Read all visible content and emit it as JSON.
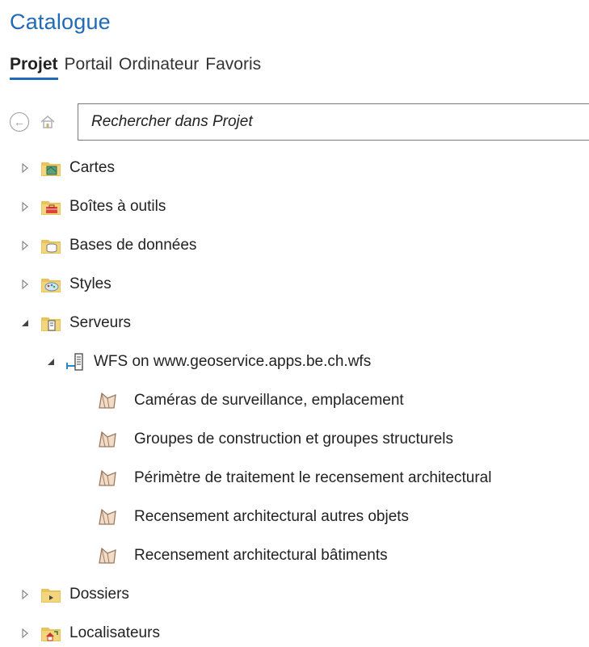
{
  "panel": {
    "title": "Catalogue"
  },
  "tabs": [
    {
      "label": "Projet",
      "active": true
    },
    {
      "label": "Portail",
      "active": false
    },
    {
      "label": "Ordinateur",
      "active": false
    },
    {
      "label": "Favoris",
      "active": false
    }
  ],
  "search": {
    "placeholder": "Rechercher dans Projet",
    "value": ""
  },
  "tree": {
    "items": [
      {
        "label": "Cartes",
        "icon": "maps-folder-icon",
        "expanded": false
      },
      {
        "label": "Boîtes à outils",
        "icon": "toolbox-folder-icon",
        "expanded": false
      },
      {
        "label": "Bases de données",
        "icon": "database-folder-icon",
        "expanded": false
      },
      {
        "label": "Styles",
        "icon": "styles-folder-icon",
        "expanded": false
      },
      {
        "label": "Serveurs",
        "icon": "servers-folder-icon",
        "expanded": true
      },
      {
        "label": "WFS on www.geoservice.apps.be.ch.wfs",
        "icon": "wfs-server-icon",
        "expanded": true
      },
      {
        "label": "Caméras de surveillance, emplacement",
        "icon": "polygon-layer-icon"
      },
      {
        "label": "Groupes de construction et groupes structurels",
        "icon": "polygon-layer-icon"
      },
      {
        "label": "Périmètre de traitement le recensement architectural",
        "icon": "polygon-layer-icon"
      },
      {
        "label": "Recensement architectural autres objets",
        "icon": "polygon-layer-icon"
      },
      {
        "label": "Recensement architectural bâtiments",
        "icon": "polygon-layer-icon"
      },
      {
        "label": "Dossiers",
        "icon": "folders-folder-icon",
        "expanded": false
      },
      {
        "label": "Localisateurs",
        "icon": "locators-folder-icon",
        "expanded": false
      }
    ]
  },
  "colors": {
    "accent": "#1f6bb5",
    "folder": "#e8c25a",
    "polygon": "#c8a98a"
  }
}
